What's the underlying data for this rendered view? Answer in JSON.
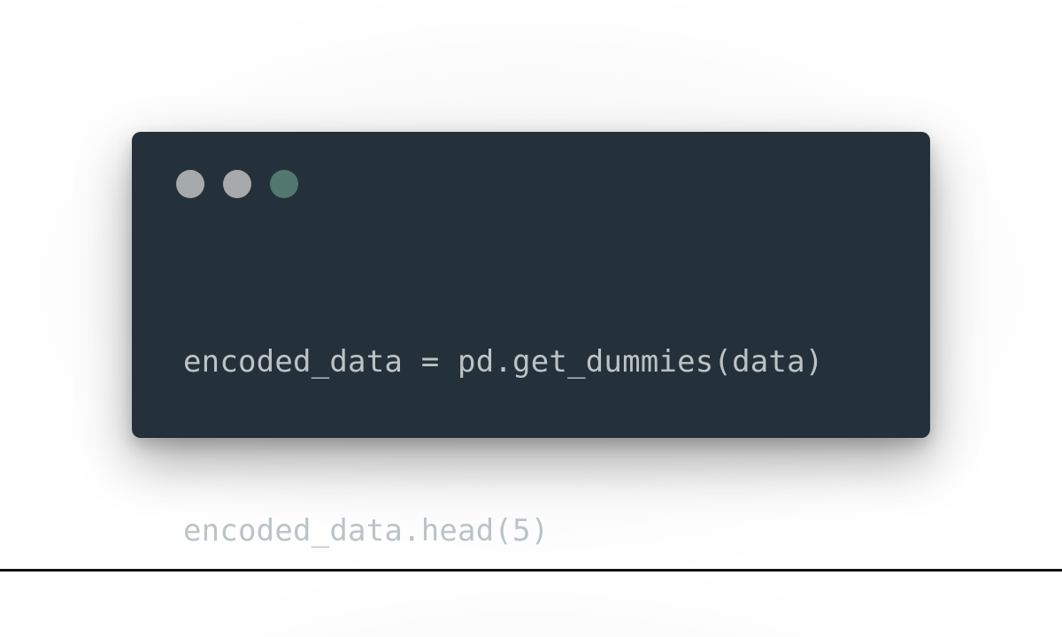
{
  "window": {
    "background_color": "#25313a",
    "controls": [
      {
        "name": "close-button",
        "color": "#a7aaab"
      },
      {
        "name": "minimize-button",
        "color": "#a7aaab"
      },
      {
        "name": "zoom-button",
        "color": "#52786f"
      }
    ]
  },
  "code": {
    "text_color": "#bcc3c6",
    "lines": [
      "encoded_data = pd.get_dummies(data)",
      "encoded_data.head(5)"
    ]
  }
}
